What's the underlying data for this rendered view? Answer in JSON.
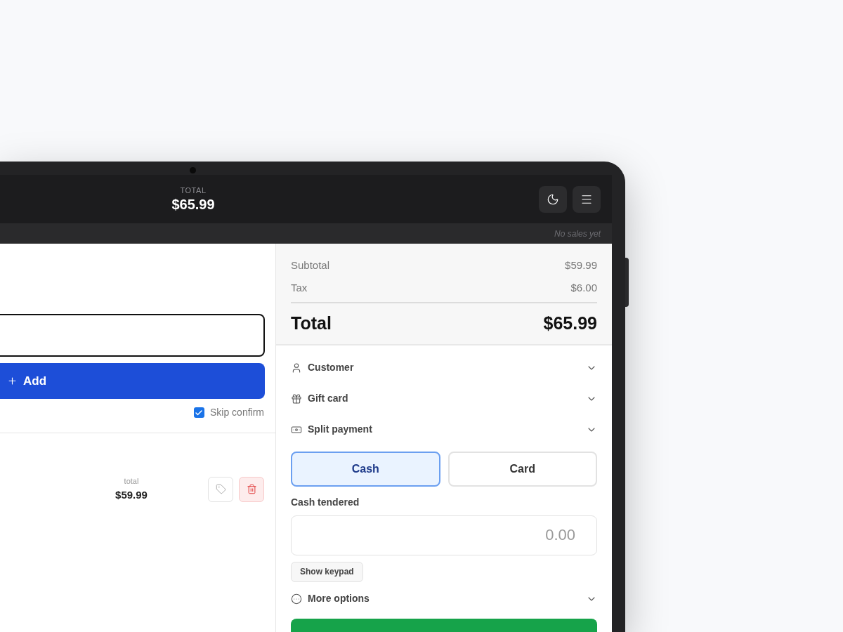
{
  "header": {
    "total_label": "TOTAL",
    "total_value": "$65.99"
  },
  "status_bar": {
    "text": "No sales yet"
  },
  "entry": {
    "add_label": "Add",
    "skip_confirm": {
      "label": "Skip confirm",
      "checked": true
    }
  },
  "line_item": {
    "total_label": "total",
    "total_value": "$59.99"
  },
  "summary": {
    "rows": [
      {
        "label": "Subtotal",
        "value": "$59.99"
      },
      {
        "label": "Tax",
        "value": "$6.00"
      }
    ],
    "total": {
      "label": "Total",
      "value": "$65.99"
    }
  },
  "sections": [
    {
      "kind": "customer",
      "label": "Customer",
      "expanded": false
    },
    {
      "kind": "gift",
      "label": "Gift card",
      "expanded": false
    },
    {
      "kind": "split",
      "label": "Split payment",
      "expanded": false
    }
  ],
  "payment_methods": [
    {
      "label": "Cash",
      "selected": true
    },
    {
      "label": "Card",
      "selected": false
    }
  ],
  "cash_tendered": {
    "label": "Cash tendered",
    "placeholder": "0.00"
  },
  "keypad_button": "Show keypad",
  "more_options": {
    "kind": "more",
    "label": "More options",
    "expanded": false
  }
}
